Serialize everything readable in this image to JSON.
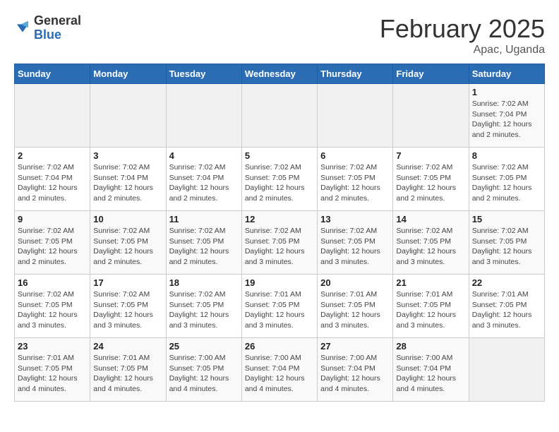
{
  "header": {
    "logo_general": "General",
    "logo_blue": "Blue",
    "title": "February 2025",
    "subtitle": "Apac, Uganda"
  },
  "weekdays": [
    "Sunday",
    "Monday",
    "Tuesday",
    "Wednesday",
    "Thursday",
    "Friday",
    "Saturday"
  ],
  "weeks": [
    [
      {
        "day": "",
        "info": ""
      },
      {
        "day": "",
        "info": ""
      },
      {
        "day": "",
        "info": ""
      },
      {
        "day": "",
        "info": ""
      },
      {
        "day": "",
        "info": ""
      },
      {
        "day": "",
        "info": ""
      },
      {
        "day": "1",
        "info": "Sunrise: 7:02 AM\nSunset: 7:04 PM\nDaylight: 12 hours\nand 2 minutes."
      }
    ],
    [
      {
        "day": "2",
        "info": "Sunrise: 7:02 AM\nSunset: 7:04 PM\nDaylight: 12 hours\nand 2 minutes."
      },
      {
        "day": "3",
        "info": "Sunrise: 7:02 AM\nSunset: 7:04 PM\nDaylight: 12 hours\nand 2 minutes."
      },
      {
        "day": "4",
        "info": "Sunrise: 7:02 AM\nSunset: 7:04 PM\nDaylight: 12 hours\nand 2 minutes."
      },
      {
        "day": "5",
        "info": "Sunrise: 7:02 AM\nSunset: 7:05 PM\nDaylight: 12 hours\nand 2 minutes."
      },
      {
        "day": "6",
        "info": "Sunrise: 7:02 AM\nSunset: 7:05 PM\nDaylight: 12 hours\nand 2 minutes."
      },
      {
        "day": "7",
        "info": "Sunrise: 7:02 AM\nSunset: 7:05 PM\nDaylight: 12 hours\nand 2 minutes."
      },
      {
        "day": "8",
        "info": "Sunrise: 7:02 AM\nSunset: 7:05 PM\nDaylight: 12 hours\nand 2 minutes."
      }
    ],
    [
      {
        "day": "9",
        "info": "Sunrise: 7:02 AM\nSunset: 7:05 PM\nDaylight: 12 hours\nand 2 minutes."
      },
      {
        "day": "10",
        "info": "Sunrise: 7:02 AM\nSunset: 7:05 PM\nDaylight: 12 hours\nand 2 minutes."
      },
      {
        "day": "11",
        "info": "Sunrise: 7:02 AM\nSunset: 7:05 PM\nDaylight: 12 hours\nand 2 minutes."
      },
      {
        "day": "12",
        "info": "Sunrise: 7:02 AM\nSunset: 7:05 PM\nDaylight: 12 hours\nand 3 minutes."
      },
      {
        "day": "13",
        "info": "Sunrise: 7:02 AM\nSunset: 7:05 PM\nDaylight: 12 hours\nand 3 minutes."
      },
      {
        "day": "14",
        "info": "Sunrise: 7:02 AM\nSunset: 7:05 PM\nDaylight: 12 hours\nand 3 minutes."
      },
      {
        "day": "15",
        "info": "Sunrise: 7:02 AM\nSunset: 7:05 PM\nDaylight: 12 hours\nand 3 minutes."
      }
    ],
    [
      {
        "day": "16",
        "info": "Sunrise: 7:02 AM\nSunset: 7:05 PM\nDaylight: 12 hours\nand 3 minutes."
      },
      {
        "day": "17",
        "info": "Sunrise: 7:02 AM\nSunset: 7:05 PM\nDaylight: 12 hours\nand 3 minutes."
      },
      {
        "day": "18",
        "info": "Sunrise: 7:02 AM\nSunset: 7:05 PM\nDaylight: 12 hours\nand 3 minutes."
      },
      {
        "day": "19",
        "info": "Sunrise: 7:01 AM\nSunset: 7:05 PM\nDaylight: 12 hours\nand 3 minutes."
      },
      {
        "day": "20",
        "info": "Sunrise: 7:01 AM\nSunset: 7:05 PM\nDaylight: 12 hours\nand 3 minutes."
      },
      {
        "day": "21",
        "info": "Sunrise: 7:01 AM\nSunset: 7:05 PM\nDaylight: 12 hours\nand 3 minutes."
      },
      {
        "day": "22",
        "info": "Sunrise: 7:01 AM\nSunset: 7:05 PM\nDaylight: 12 hours\nand 3 minutes."
      }
    ],
    [
      {
        "day": "23",
        "info": "Sunrise: 7:01 AM\nSunset: 7:05 PM\nDaylight: 12 hours\nand 4 minutes."
      },
      {
        "day": "24",
        "info": "Sunrise: 7:01 AM\nSunset: 7:05 PM\nDaylight: 12 hours\nand 4 minutes."
      },
      {
        "day": "25",
        "info": "Sunrise: 7:00 AM\nSunset: 7:05 PM\nDaylight: 12 hours\nand 4 minutes."
      },
      {
        "day": "26",
        "info": "Sunrise: 7:00 AM\nSunset: 7:04 PM\nDaylight: 12 hours\nand 4 minutes."
      },
      {
        "day": "27",
        "info": "Sunrise: 7:00 AM\nSunset: 7:04 PM\nDaylight: 12 hours\nand 4 minutes."
      },
      {
        "day": "28",
        "info": "Sunrise: 7:00 AM\nSunset: 7:04 PM\nDaylight: 12 hours\nand 4 minutes."
      },
      {
        "day": "",
        "info": ""
      }
    ]
  ]
}
